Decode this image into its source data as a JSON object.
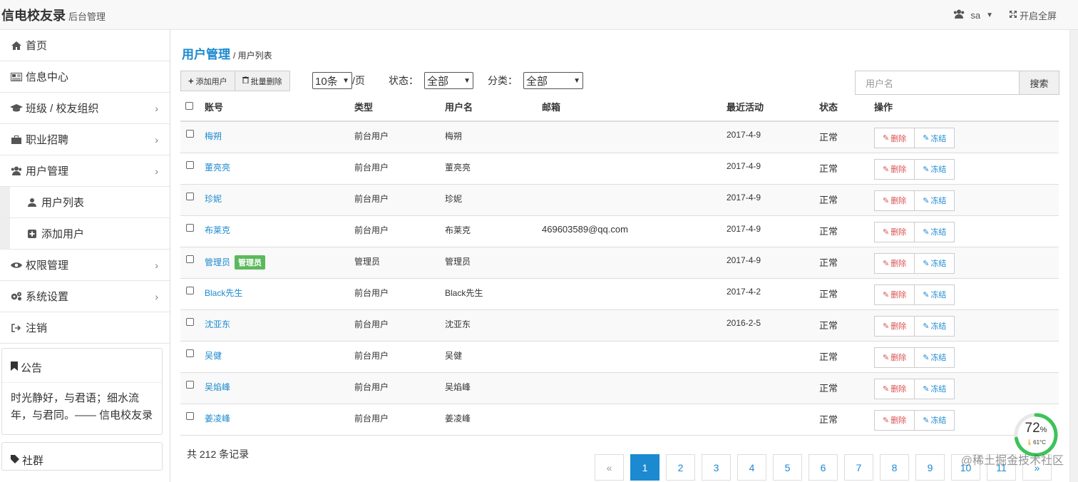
{
  "header": {
    "brand": "信电校友录",
    "subtitle": "后台管理",
    "user": "sa",
    "fullscreen": "开启全屏"
  },
  "sidebar": {
    "items": [
      {
        "label": "首页",
        "icon": "home-icon"
      },
      {
        "label": "信息中心",
        "icon": "newspaper-icon"
      },
      {
        "label": "班级 / 校友组织",
        "icon": "graduation-cap-icon",
        "expandable": true
      },
      {
        "label": "职业招聘",
        "icon": "briefcase-icon",
        "expandable": true
      },
      {
        "label": "用户管理",
        "icon": "users-icon",
        "expandable": true
      },
      {
        "label": "用户列表",
        "icon": "user-icon",
        "sub": true
      },
      {
        "label": "添加用户",
        "icon": "plus-square-icon",
        "sub": true
      },
      {
        "label": "权限管理",
        "icon": "eye-icon",
        "expandable": true
      },
      {
        "label": "系统设置",
        "icon": "cogs-icon",
        "expandable": true
      },
      {
        "label": "注销",
        "icon": "sign-out-icon"
      }
    ],
    "notice_title": "公告",
    "notice_body": "时光静好，与君语；细水流年，与君同。—— 信电校友录",
    "community_title": "社群"
  },
  "main": {
    "title": "用户管理",
    "subtitle": "/ 用户列表",
    "add_user_label": "添加用户",
    "batch_delete_label": "批量删除",
    "page_size": "10条",
    "page_size_suffix": "/页",
    "status_label": "状态：",
    "status_value": "全部",
    "category_label": "分类：",
    "category_value": "全部",
    "search_placeholder": "用户名",
    "search_button": "搜索",
    "columns": [
      "账号",
      "类型",
      "用户名",
      "邮箱",
      "最近活动",
      "状态",
      "操作"
    ],
    "rows": [
      {
        "account": "梅朔",
        "badge": "",
        "type": "前台用户",
        "username": "梅朔",
        "email": "",
        "last": "2017-4-9",
        "status": "正常"
      },
      {
        "account": "董亮亮",
        "badge": "",
        "type": "前台用户",
        "username": "董亮亮",
        "email": "",
        "last": "2017-4-9",
        "status": "正常"
      },
      {
        "account": "珍妮",
        "badge": "",
        "type": "前台用户",
        "username": "珍妮",
        "email": "",
        "last": "2017-4-9",
        "status": "正常"
      },
      {
        "account": "布莱克",
        "badge": "",
        "type": "前台用户",
        "username": "布莱克",
        "email": "469603589@qq.com",
        "last": "2017-4-9",
        "status": "正常"
      },
      {
        "account": "管理员",
        "badge": "管理员",
        "type": "管理员",
        "username": "管理员",
        "email": "",
        "last": "2017-4-9",
        "status": "正常"
      },
      {
        "account": "Black先生",
        "badge": "",
        "type": "前台用户",
        "username": "Black先生",
        "email": "",
        "last": "2017-4-2",
        "status": "正常"
      },
      {
        "account": "沈亚东",
        "badge": "",
        "type": "前台用户",
        "username": "沈亚东",
        "email": "",
        "last": "2016-2-5",
        "status": "正常"
      },
      {
        "account": "吴健",
        "badge": "",
        "type": "前台用户",
        "username": "吴健",
        "email": "",
        "last": "",
        "status": "正常"
      },
      {
        "account": "吴焰峰",
        "badge": "",
        "type": "前台用户",
        "username": "吴焰峰",
        "email": "",
        "last": "",
        "status": "正常"
      },
      {
        "account": "姜凌峰",
        "badge": "",
        "type": "前台用户",
        "username": "姜凌峰",
        "email": "",
        "last": "",
        "status": "正常"
      }
    ],
    "delete_label": "删除",
    "freeze_label": "冻结",
    "total": "共 212 条记录",
    "pages": [
      "«",
      "1",
      "2",
      "3",
      "4",
      "5",
      "6",
      "7",
      "8",
      "9",
      "10",
      "11",
      "»"
    ],
    "active_page": "1"
  },
  "overlay": {
    "gauge_value": "72",
    "gauge_unit": "%",
    "gauge_temp": "61°C",
    "gauge_level": 0.72,
    "watermark": "@稀土掘金技术社区"
  },
  "colors": {
    "accent": "#1b8ad0",
    "badge": "#5cb85c",
    "danger": "#d9534f",
    "gauge": "#3cc35a"
  }
}
